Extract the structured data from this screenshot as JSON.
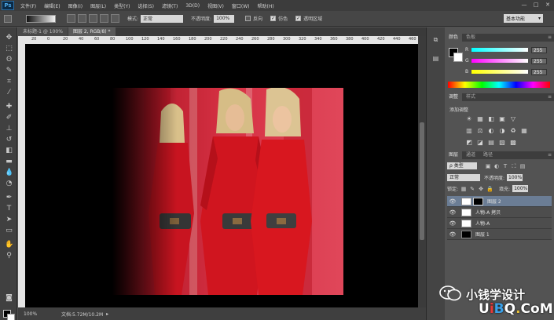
{
  "app": {
    "logo": "Ps",
    "menus": [
      "文件(F)",
      "编辑(E)",
      "图像(I)",
      "图层(L)",
      "类型(Y)",
      "选择(S)",
      "滤镜(T)",
      "3D(D)",
      "视图(V)",
      "窗口(W)",
      "帮助(H)"
    ],
    "window_buttons": [
      "—",
      "□",
      "✕"
    ]
  },
  "options_bar": {
    "mode_label": "模式:",
    "mode_value": "正常",
    "opacity_label": "不透明度:",
    "opacity_value": "100%",
    "reverse_label": "反向",
    "reverse_checked": false,
    "dither_label": "仿色",
    "dither_checked": true,
    "transparency_label": "透明区域",
    "transparency_checked": true,
    "workspace": "基本功能"
  },
  "document_tabs": [
    {
      "label": "未标题-1 @ 100%",
      "active": false
    },
    {
      "label": "图层 2, RGB/8) *",
      "active": true
    }
  ],
  "ruler": {
    "marks": [
      "20",
      "0",
      "20",
      "40",
      "60",
      "80",
      "100",
      "120",
      "140",
      "160",
      "180",
      "200",
      "220",
      "240",
      "260",
      "280",
      "300",
      "320",
      "340",
      "360",
      "380",
      "400",
      "420",
      "440",
      "460"
    ]
  },
  "status": {
    "zoom": "100%",
    "doc_size": "文档:5.72M/10.2M"
  },
  "color_panel": {
    "tabs": [
      "颜色",
      "色板"
    ],
    "channels": [
      {
        "label": "R",
        "value": "255",
        "gradient": "linear-gradient(to right, #00ffff, #ffffff)"
      },
      {
        "label": "G",
        "value": "255",
        "gradient": "linear-gradient(to right, #ff00ff, #ffffff)"
      },
      {
        "label": "B",
        "value": "255",
        "gradient": "linear-gradient(to right, #ffff00, #ffffff)"
      }
    ]
  },
  "adjustments_panel": {
    "tabs": [
      "调整",
      "样式"
    ],
    "title": "添加调整",
    "row1": [
      "☀",
      "▦",
      "◧",
      "▣",
      "▽"
    ],
    "row2": [
      "▥",
      "⚖",
      "◐",
      "◑",
      "♻",
      "▦"
    ],
    "row3": [
      "◩",
      "◪",
      "▤",
      "▧",
      "▩"
    ]
  },
  "layers_panel": {
    "tabs": [
      "图层",
      "通道",
      "路径"
    ],
    "kind_filter": "ρ 类型",
    "filter_icons": [
      "▣",
      "◐",
      "T",
      "⛶",
      "▤"
    ],
    "blend_mode": "正常",
    "opacity_label": "不透明度:",
    "opacity_value": "100%",
    "lock_label": "锁定:",
    "lock_icons": [
      "▦",
      "✎",
      "✥",
      "🔒"
    ],
    "fill_label": "填充:",
    "fill_value": "100%",
    "layers": [
      {
        "name": "图层 2",
        "selected": true,
        "thumb": "#ffffff",
        "has_mask": true
      },
      {
        "name": "人物-A 拷贝",
        "selected": false,
        "thumb": "#ffffff",
        "has_mask": false
      },
      {
        "name": "人物-A",
        "selected": false,
        "thumb": "#ffffff",
        "has_mask": false
      },
      {
        "name": "图层 1",
        "selected": false,
        "thumb": "#000000",
        "has_mask": false
      }
    ],
    "bottom_icons": [
      "⚭",
      "fx",
      "◘",
      "◐",
      "▭",
      "▤",
      "🗑"
    ]
  },
  "watermark": {
    "text": "小钱学设计",
    "logo": "UiBQ.CoM"
  },
  "colors": {
    "canvas_bg": "#000000",
    "dress_red": "#cc1522",
    "backdrop_red": "#d42a3b",
    "selection_blue": "#6b7d95"
  }
}
